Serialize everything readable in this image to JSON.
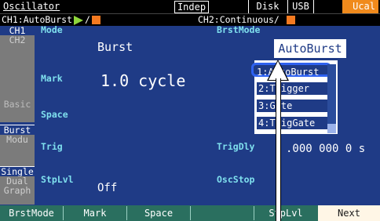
{
  "topbar": {
    "title": "Oscillator",
    "indep": "Indep",
    "disk": "Disk",
    "usb": "USB",
    "ucal": "Ucal",
    "ucal_color": "#f08a1c"
  },
  "channels": {
    "ch1_label": "CH1:AutoBurst",
    "ch2_label": "CH2:Continuous/",
    "slash": "/",
    "run_color": "#8ed63b",
    "stop_color": "#f47a20"
  },
  "left_tabs": {
    "ch1": "CH1",
    "ch2": "CH2",
    "basic": "Basic",
    "burst": "Burst",
    "modu": "Modu",
    "single": "Single",
    "dual": "Dual",
    "graph": "Graph"
  },
  "params": {
    "mode_label": "Mode",
    "mode_value": "Burst",
    "mark_label": "Mark",
    "mark_value": "1.0 cycle",
    "space_label": "Space",
    "trig_label": "Trig",
    "stplvl_label": "StpLvl",
    "stplvl_value": "Off",
    "brstmode_label": "BrstMode",
    "trigdly_label": "TrigDly",
    "trigdly_value": ".000 000 0 s",
    "oscstop_label": "OscStop"
  },
  "dropdown": {
    "selected_value": "AutoBurst",
    "options": [
      "1:AutoBurst",
      "2:Trigger",
      "3:Gate",
      "4:TrigGate"
    ]
  },
  "softkeys": {
    "k1": "BrstMode",
    "k2": "Mark",
    "k3": "Space",
    "k4": "",
    "k5": "StpLvl",
    "k6": "Next"
  }
}
